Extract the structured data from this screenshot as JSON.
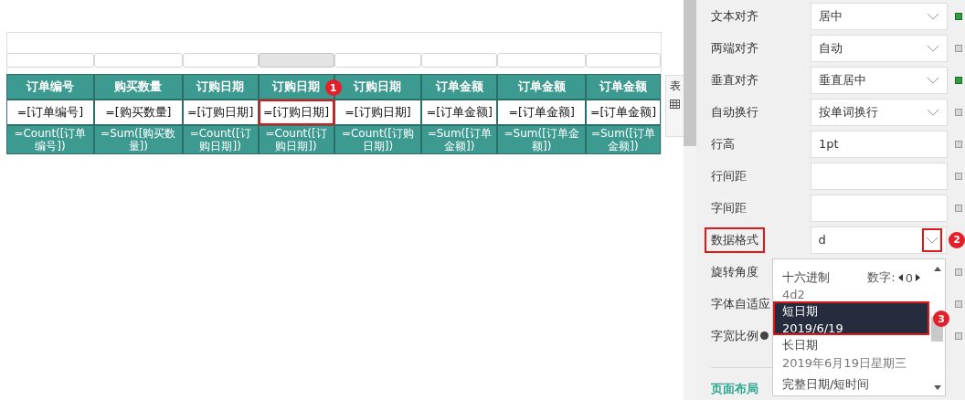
{
  "column_strip": [
    {
      "selected": false
    },
    {
      "selected": false
    },
    {
      "selected": false
    },
    {
      "selected": true
    },
    {
      "selected": false
    },
    {
      "selected": false
    },
    {
      "selected": false
    },
    {
      "selected": false
    }
  ],
  "table": {
    "header": [
      {
        "label": "订单编号"
      },
      {
        "label": "购买数量"
      },
      {
        "label": "订购日期"
      },
      {
        "label": "订购日期",
        "badge": "1"
      },
      {
        "label": "订购日期"
      },
      {
        "label": "订单金额"
      },
      {
        "label": "订单金额"
      },
      {
        "label": "订单金额"
      }
    ],
    "data_row": [
      {
        "text": "=[订单编号]",
        "highlighted": false
      },
      {
        "text": "=[购买数量]",
        "highlighted": false
      },
      {
        "text": "=[订购日期]",
        "highlighted": false
      },
      {
        "text": "=[订购日期]",
        "highlighted": true
      },
      {
        "text": "=[订购日期]",
        "highlighted": false
      },
      {
        "text": "=[订单金额]",
        "highlighted": false
      },
      {
        "text": "=[订单金额]",
        "highlighted": false
      },
      {
        "text": "=[订单金额]",
        "highlighted": false
      }
    ],
    "summary_row": [
      "=Count([订单编号])",
      "=Sum([购买数量])",
      "=Count([订购日期])",
      "=Count([订购日期])",
      "=Count([订购日期])",
      "=Sum([订单金额])",
      "=Sum([订单金额])",
      "=Sum([订单金额])"
    ]
  },
  "side_tab": {
    "label": "表"
  },
  "properties": [
    {
      "label": "文本对齐",
      "kind": "select",
      "value": "居中",
      "indicator_on": true
    },
    {
      "label": "两端对齐",
      "kind": "select",
      "value": "自动",
      "indicator_on": false
    },
    {
      "label": "垂直对齐",
      "kind": "select",
      "value": "垂直居中",
      "indicator_on": true
    },
    {
      "label": "自动换行",
      "kind": "select",
      "value": "按单词换行",
      "indicator_on": false
    },
    {
      "label": "行高",
      "kind": "input",
      "value": "1pt",
      "indicator_on": false
    },
    {
      "label": "行间距",
      "kind": "input",
      "indicator_on": false
    },
    {
      "label": "字间距",
      "kind": "input",
      "indicator_on": false
    },
    {
      "label": "数据格式",
      "kind": "select",
      "value": "d",
      "highlighted": true,
      "badge": "2"
    },
    {
      "label": "旋转角度",
      "kind": "covered",
      "indicator_on": false
    },
    {
      "label": "字体自适应",
      "kind": "covered",
      "indicator_on": false
    },
    {
      "label": "字宽比例",
      "kind": "covered",
      "has_info": true,
      "indicator_on": false
    }
  ],
  "dropdown": {
    "items": [
      {
        "title": "十六进制",
        "sample": "4d2",
        "selected": false,
        "stepper": {
          "label": "数字:",
          "value": "0"
        }
      },
      {
        "title": "短日期",
        "sample": "2019/6/19",
        "selected": true,
        "badge": "3"
      },
      {
        "title": "长日期",
        "sample": "2019年6月19日星期三",
        "selected": false
      },
      {
        "title": "完整日期/短时间",
        "selected": false
      }
    ]
  },
  "section_link": "页面布局"
}
